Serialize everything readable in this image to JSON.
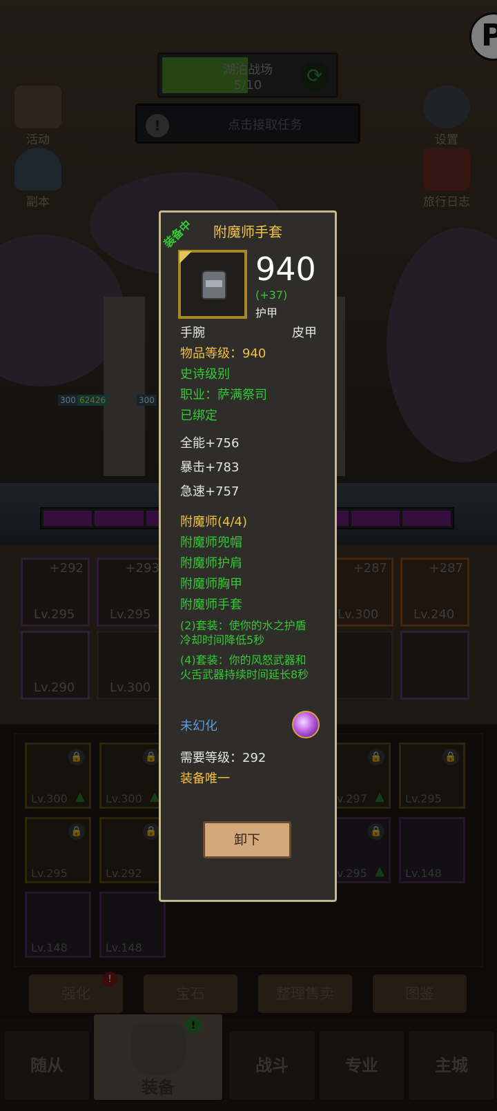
{
  "top_bar": {
    "title": "湖泊战场",
    "progress": "5/10",
    "progress_fraction": 0.5,
    "task_label": "点击接取任务"
  },
  "side_buttons": {
    "activity": "活动",
    "dungeon": "副本",
    "settings": "设置",
    "journal": "旅行日志"
  },
  "hero_tags": [
    "300",
    "62426",
    "300"
  ],
  "equip_slots": [
    {
      "plus": "+292",
      "level": "Lv.295",
      "rarity": "epic"
    },
    {
      "plus": "+293",
      "level": "Lv.295",
      "rarity": "epic"
    },
    {
      "plus": "+287",
      "level": "Lv.300",
      "rarity": "legendary"
    },
    {
      "plus": "+287",
      "level": "Lv.240",
      "rarity": "legendary"
    },
    {
      "plus": "",
      "level": "Lv.290",
      "rarity": "rare"
    },
    {
      "plus": "",
      "level": "Lv.300",
      "rarity": "epic"
    },
    {
      "plus": "",
      "level": "",
      "rarity": "epic"
    },
    {
      "plus": "",
      "level": "",
      "rarity": "rare"
    }
  ],
  "bag_slots": [
    {
      "level": "Lv.300",
      "locked": true,
      "upgrade": true
    },
    {
      "level": "Lv.300",
      "locked": true,
      "upgrade": true
    },
    {
      "level": "Lv.297",
      "locked": true,
      "upgrade": true
    },
    {
      "level": "Lv.295",
      "locked": true,
      "upgrade": false
    },
    {
      "level": "Lv.295",
      "locked": true,
      "upgrade": false
    },
    {
      "level": "Lv.292",
      "locked": true,
      "upgrade": false
    },
    {
      "level": "Lv.295",
      "locked": true,
      "upgrade": true
    },
    {
      "level": "Lv.148",
      "locked": false,
      "upgrade": false
    },
    {
      "level": "Lv.148",
      "locked": false,
      "upgrade": false
    },
    {
      "level": "Lv.148",
      "locked": false,
      "upgrade": false
    }
  ],
  "actions": {
    "enhance": "强化",
    "gem": "宝石",
    "sort_sell": "整理售卖",
    "collection": "图鉴"
  },
  "nav": {
    "followers": "随从",
    "equipment": "装备",
    "battle": "战斗",
    "profession": "专业",
    "main_city": "主城",
    "badge": "!"
  },
  "tooltip": {
    "equipped_tag": "装备中",
    "name": "附魔师手套",
    "item_power": "940",
    "delta": "(+37)",
    "stat_type": "护甲",
    "slot": "手腕",
    "material": "皮甲",
    "item_level": "物品等级：940",
    "quality": "史诗级别",
    "class": "职业：萨满祭司",
    "bound": "已绑定",
    "stats": [
      "全能+756",
      "暴击+783",
      "急速+757"
    ],
    "set_name": "附魔师(4/4)",
    "set_items": [
      "附魔师兜帽",
      "附魔师护肩",
      "附魔师胸甲",
      "附魔师手套"
    ],
    "set_bonus_2": "(2)套装：使你的水之护盾冷却时间降低5秒",
    "set_bonus_4": "(4)套装：你的风怒武器和火舌武器持续时间延长8秒",
    "transmog": "未幻化",
    "req_level": "需要等级：292",
    "unique": "装备唯一",
    "unequip": "卸下"
  },
  "colors": {
    "quality_gold": "#f0c040",
    "green": "#35c835",
    "blue": "#5a9ae0",
    "border": "#c7b98f"
  }
}
